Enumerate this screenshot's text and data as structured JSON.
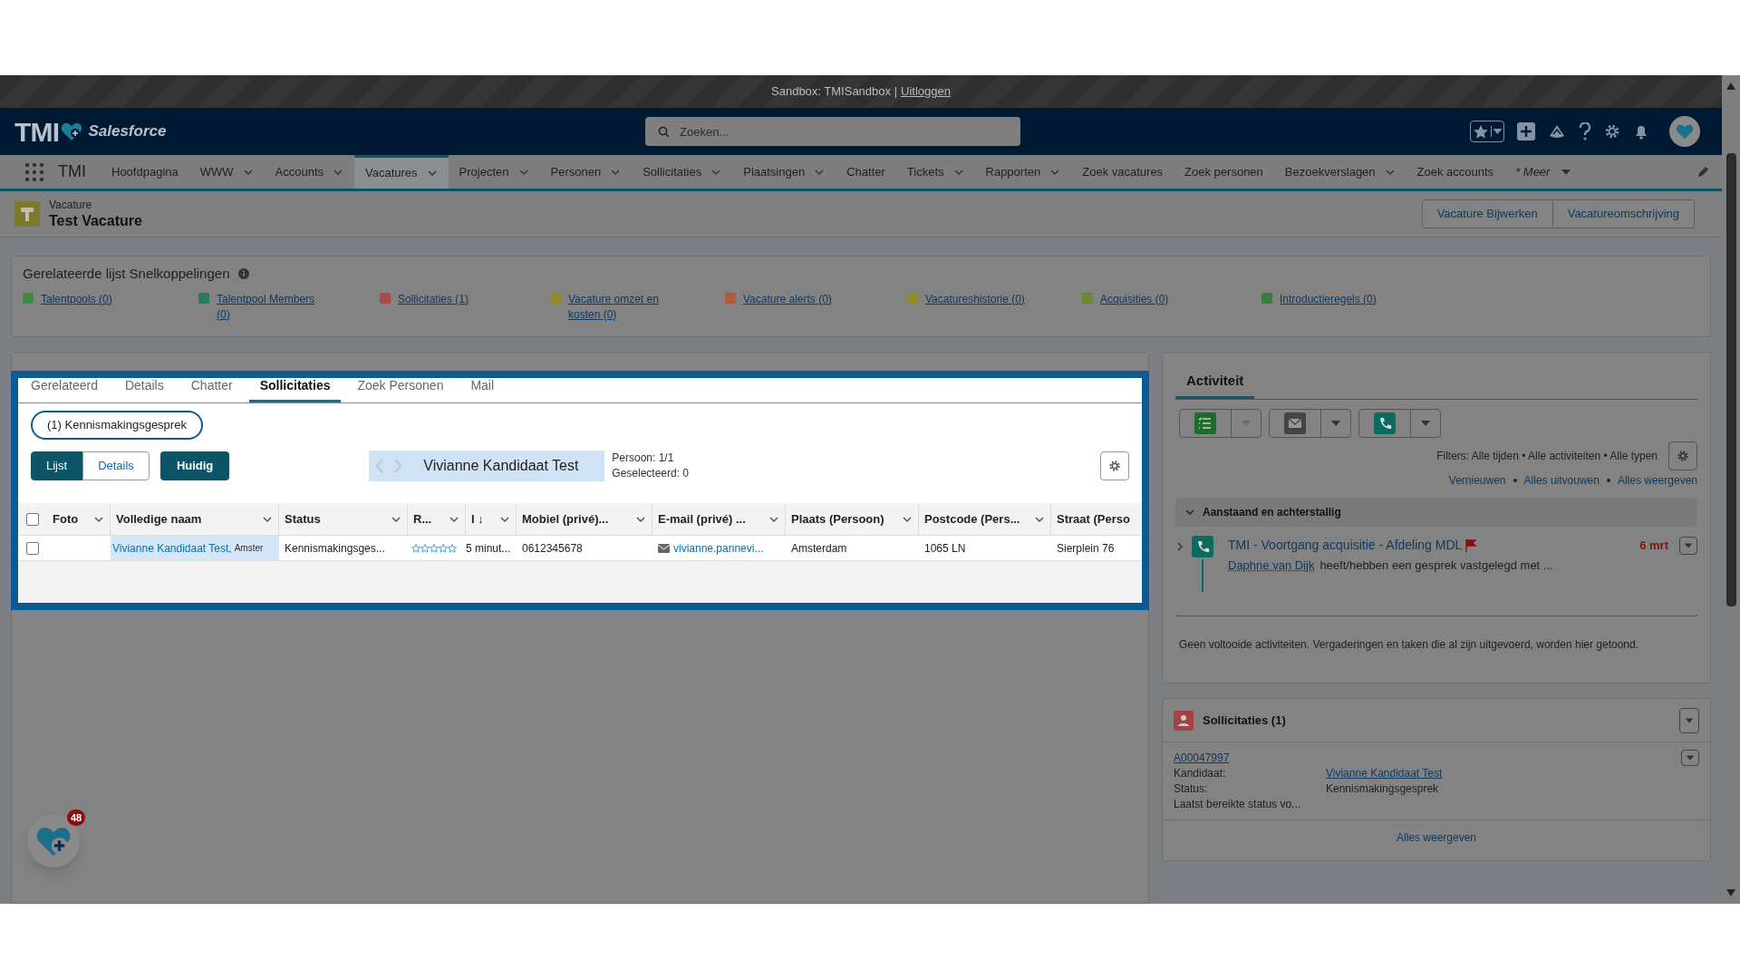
{
  "sandbox_bar": {
    "text": "Sandbox: TMISandbox |",
    "link": "Uitloggen"
  },
  "header": {
    "logo": "TMI",
    "brand": "Salesforce",
    "search": {
      "placeholder": "Zoeken..."
    }
  },
  "nav": {
    "app_name": "TMI",
    "items": [
      {
        "label": "Hoofdpagina",
        "dropdown": false,
        "selected": false
      },
      {
        "label": "WWW",
        "dropdown": true,
        "selected": false
      },
      {
        "label": "Accounts",
        "dropdown": true,
        "selected": false
      },
      {
        "label": "Vacatures",
        "dropdown": true,
        "selected": true
      },
      {
        "label": "Projecten",
        "dropdown": true,
        "selected": false
      },
      {
        "label": "Personen",
        "dropdown": true,
        "selected": false
      },
      {
        "label": "Sollicitaties",
        "dropdown": true,
        "selected": false
      },
      {
        "label": "Plaatsingen",
        "dropdown": true,
        "selected": false
      },
      {
        "label": "Chatter",
        "dropdown": false,
        "selected": false
      },
      {
        "label": "Tickets",
        "dropdown": true,
        "selected": false
      },
      {
        "label": "Rapporten",
        "dropdown": true,
        "selected": false
      },
      {
        "label": "Zoek vacatures",
        "dropdown": false,
        "selected": false
      },
      {
        "label": "Zoek personen",
        "dropdown": false,
        "selected": false
      },
      {
        "label": "Bezoekverslagen",
        "dropdown": true,
        "selected": false
      },
      {
        "label": "Zoek accounts",
        "dropdown": false,
        "selected": false
      }
    ],
    "more": "* Meer"
  },
  "record": {
    "type": "Vacature",
    "title": "Test Vacature",
    "actions": [
      "Vacature Bijwerken",
      "Vacatureomschrijving"
    ]
  },
  "related_links": {
    "title": "Gerelateerde lijst Snelkoppelingen",
    "links": [
      {
        "label": "Talentpools (0)",
        "color": "#3d8a4a"
      },
      {
        "label": "Talentpool Members (0)",
        "color": "#2a7a5e"
      },
      {
        "label": "Sollicitaties (1)",
        "color": "#b04848"
      },
      {
        "label": "Vacature omzet en kosten (0)",
        "color": "#8f8a2a"
      },
      {
        "label": "Vacature alerts (0)",
        "color": "#b05a3a"
      },
      {
        "label": "Vacatureshistorie (0)",
        "color": "#8f8a2a"
      },
      {
        "label": "Acquisities (0)",
        "color": "#6b8a2a"
      },
      {
        "label": "Introductieregels (0)",
        "color": "#3a7a3a"
      }
    ]
  },
  "tabs": [
    {
      "label": "Gerelateerd",
      "selected": false
    },
    {
      "label": "Details",
      "selected": false
    },
    {
      "label": "Chatter",
      "selected": false
    },
    {
      "label": "Sollicitaties",
      "selected": true
    },
    {
      "label": "Zoek Personen",
      "selected": false
    },
    {
      "label": "Mail",
      "selected": false
    }
  ],
  "filter_pill": "(1) Kennismakingsgesprek",
  "view_toggle": [
    {
      "label": "Lijst",
      "selected": true
    },
    {
      "label": "Details",
      "selected": false
    }
  ],
  "current_button": "Huidig",
  "pager": {
    "name": "Vivianne Kandidaat Test",
    "info": [
      "Persoon: 1/1",
      "Geselecteerd: 0"
    ]
  },
  "table": {
    "select_all": {
      "checked": false
    },
    "columns": [
      "Foto",
      "Volledige naam",
      "Status",
      "R...",
      "I ↓",
      "Mobiel (privé)...",
      "E-mail (privé) ...",
      "Plaats (Persoon)",
      "Postcode (Pers...",
      "Straat (Perso"
    ],
    "rows": [
      {
        "checked": false,
        "name": "Vivianne Kandidaat Test,",
        "name_extra": "Amster",
        "status": "Kennismakingsges...",
        "stars": 0,
        "time": "5 minut...",
        "mobile": "0612345678",
        "email": "vivianne.pannevi...",
        "city": "Amsterdam",
        "postcode": "1065 LN",
        "street": "Sierplein 76"
      }
    ]
  },
  "activity": {
    "title": "Activiteit",
    "filters": "Filters: Alle tijden • Alle activiteiten • Alle typen",
    "links": [
      "Vernieuwen",
      "Alles uitvouwen",
      "Alles weergeven"
    ],
    "section": {
      "title": "Aanstaand en achterstallig",
      "expanded": true,
      "items": [
        {
          "title": "TMI - Voortgang acquisitie - Afdeling MDL",
          "owner": "Daphne van Dijk",
          "text": "heeft/hebben een gesprek vastgelegd met ...",
          "date": "6 mrt",
          "expanded": false
        }
      ]
    },
    "empty": "Geen voltooide activiteiten. Vergaderingen en taken die al zijn uitgevoerd, worden hier getoond."
  },
  "sollicitaties_card": {
    "title": "Sollicitaties (1)",
    "record": "A00047997",
    "fields": [
      {
        "label": "Kandidaat:",
        "value": "Vivianne Kandidaat Test",
        "link": true
      },
      {
        "label": "Status:",
        "value": "Kennismakingsgesprek",
        "link": false
      },
      {
        "label": "Laatst bereikte status vo..."
      }
    ],
    "footer": "Alles weergeven"
  },
  "notification_badge": "48"
}
